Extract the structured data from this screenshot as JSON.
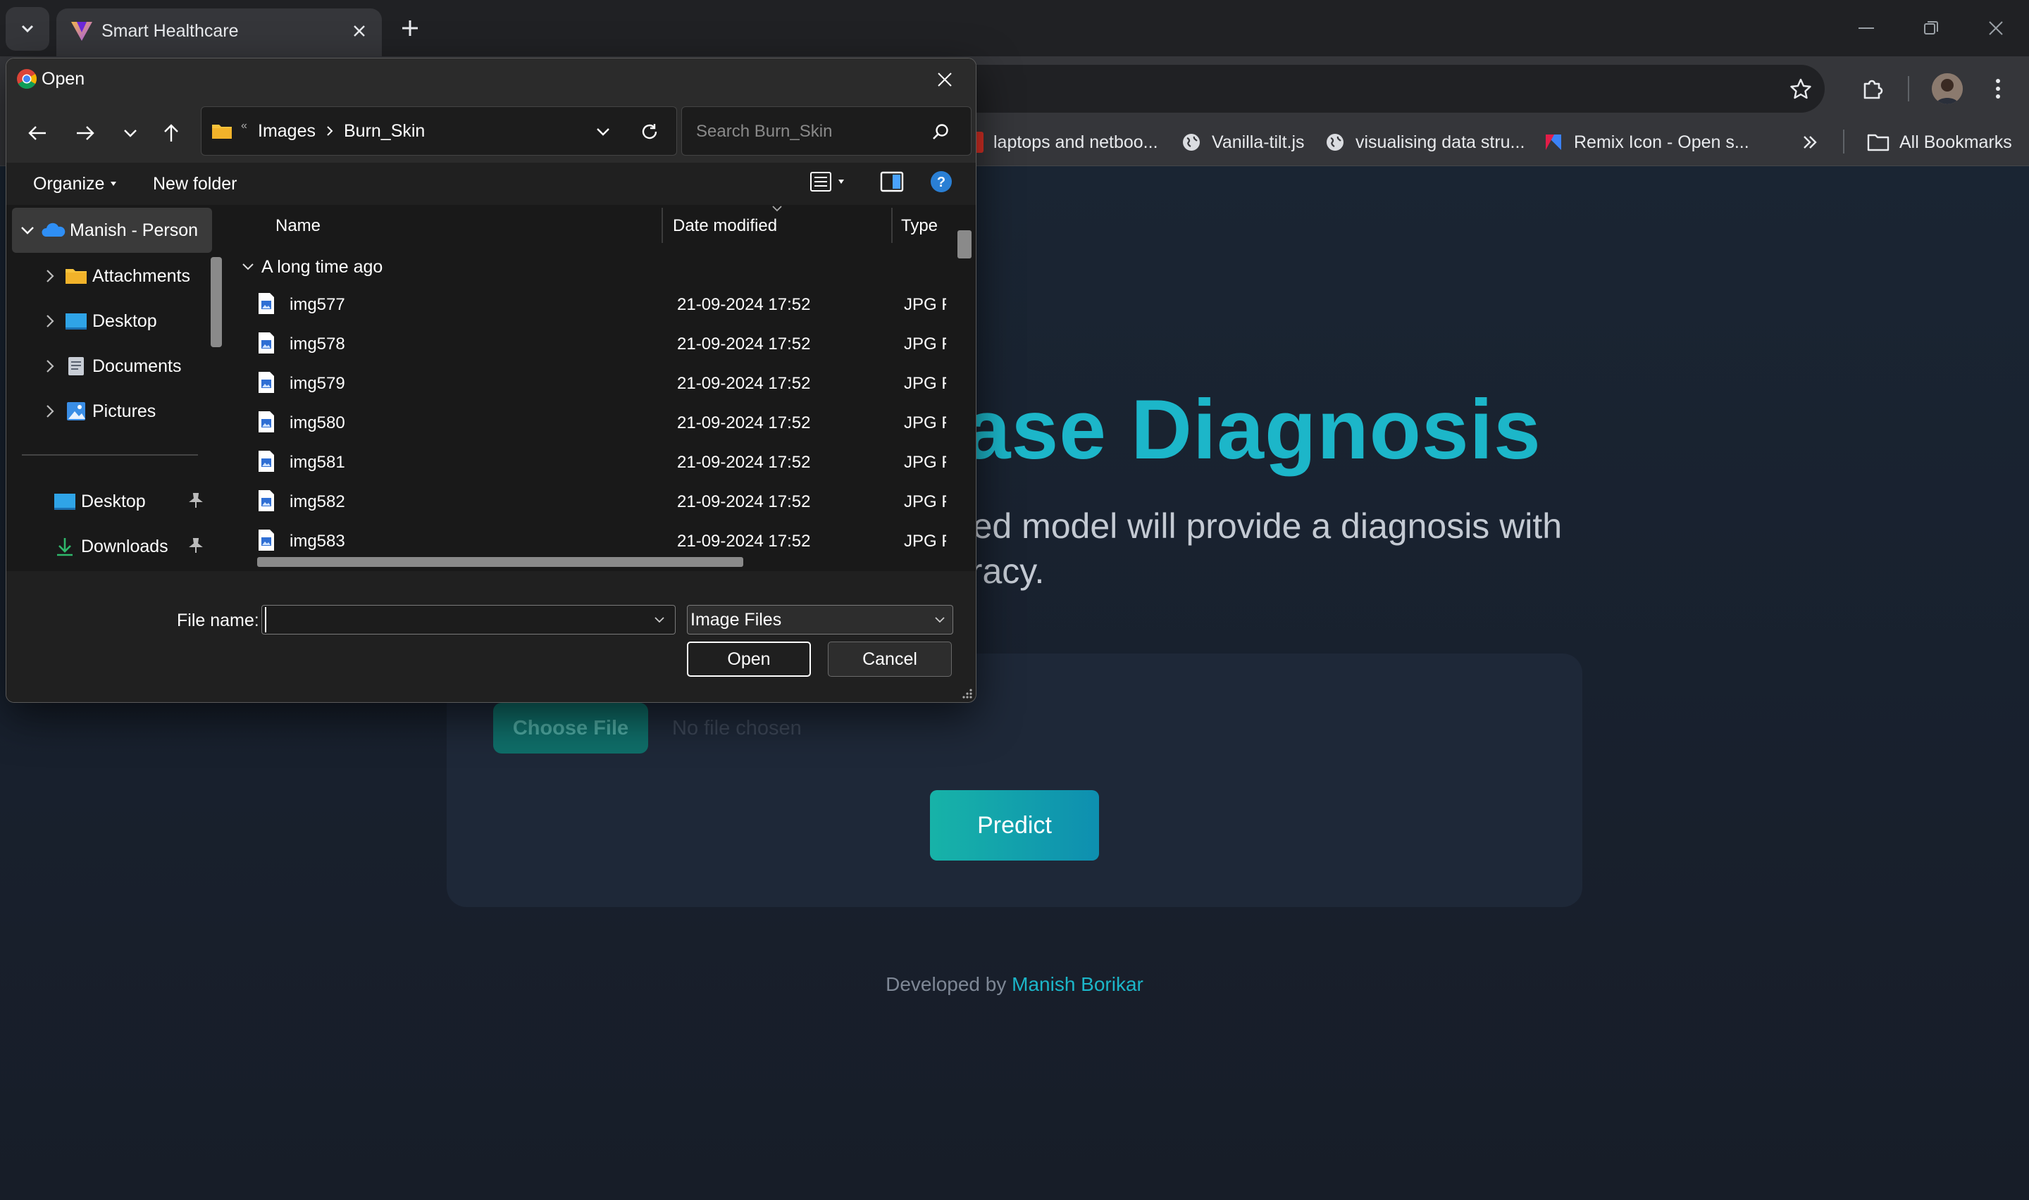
{
  "browser": {
    "tab_title": "Smart Healthcare",
    "bookmarks": [
      {
        "label": "laptops and netboo...",
        "icon": "red-square"
      },
      {
        "label": "Vanilla-tilt.js",
        "icon": "globe-icon"
      },
      {
        "label": "visualising data stru...",
        "icon": "globe-icon"
      },
      {
        "label": "Remix Icon - Open s...",
        "icon": "remix-icon"
      }
    ],
    "all_bookmarks": "All Bookmarks"
  },
  "page": {
    "title_visible": "ease Diagnosis",
    "subtitle_line1": "wered model will provide a diagnosis with",
    "subtitle_line2": "ccuracy.",
    "choose_file": "Choose File",
    "no_file": "No file chosen",
    "predict": "Predict",
    "footer_prefix": "Developed by",
    "footer_author": "Manish Borikar",
    "accent_color": "#1cb6c9"
  },
  "dialog": {
    "title": "Open",
    "breadcrumb": [
      "Images",
      "Burn_Skin"
    ],
    "search_placeholder": "Search Burn_Skin",
    "organize": "Organize",
    "new_folder": "New folder",
    "nav_items": [
      {
        "label": "Manish - Person",
        "icon": "onedrive-icon"
      },
      {
        "label": "Attachments",
        "icon": "folder-icon"
      },
      {
        "label": "Desktop",
        "icon": "desktop-icon"
      },
      {
        "label": "Documents",
        "icon": "documents-icon"
      },
      {
        "label": "Pictures",
        "icon": "pictures-icon"
      },
      {
        "label": "Desktop",
        "icon": "desktop-icon"
      },
      {
        "label": "Downloads",
        "icon": "downloads-icon"
      }
    ],
    "columns": {
      "name": "Name",
      "date": "Date modified",
      "type": "Type"
    },
    "group": "A long time ago",
    "files": [
      {
        "name": "img577",
        "date": "21-09-2024 17:52",
        "type": "JPG File"
      },
      {
        "name": "img578",
        "date": "21-09-2024 17:52",
        "type": "JPG File"
      },
      {
        "name": "img579",
        "date": "21-09-2024 17:52",
        "type": "JPG File"
      },
      {
        "name": "img580",
        "date": "21-09-2024 17:52",
        "type": "JPG File"
      },
      {
        "name": "img581",
        "date": "21-09-2024 17:52",
        "type": "JPG File"
      },
      {
        "name": "img582",
        "date": "21-09-2024 17:52",
        "type": "JPG File"
      },
      {
        "name": "img583",
        "date": "21-09-2024 17:52",
        "type": "JPG File"
      }
    ],
    "file_name_label": "File name:",
    "file_name_value": "",
    "filter": "Image Files",
    "open": "Open",
    "cancel": "Cancel"
  }
}
